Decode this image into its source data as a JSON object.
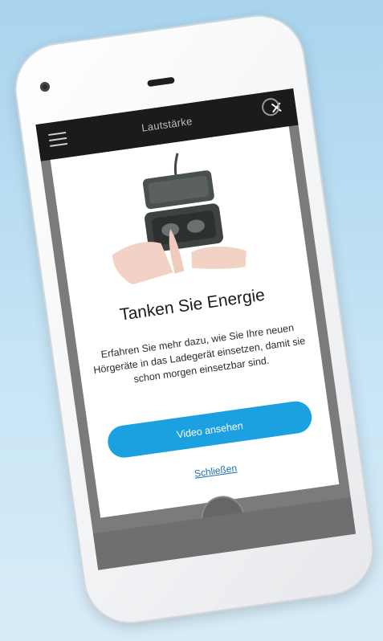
{
  "header": {
    "title": "Lautstärke"
  },
  "modal": {
    "title": "Tanken Sie Energie",
    "body": "Erfahren Sie mehr dazu, wie Sie Ihre neuen Hörgeräte in das Ladegerät einsetzen, damit sie schon morgen einsetzbar sind.",
    "primary_button": "Video ansehen",
    "secondary_link": "Schließen"
  },
  "icons": {
    "menu": "menu-icon",
    "close": "close-icon"
  },
  "colors": {
    "header_bg": "#1b1b1b",
    "primary_button": "#1ba1e0",
    "link": "#1a6fb3",
    "overlay": "#7b7b7b",
    "background": "#a9d4ee"
  }
}
